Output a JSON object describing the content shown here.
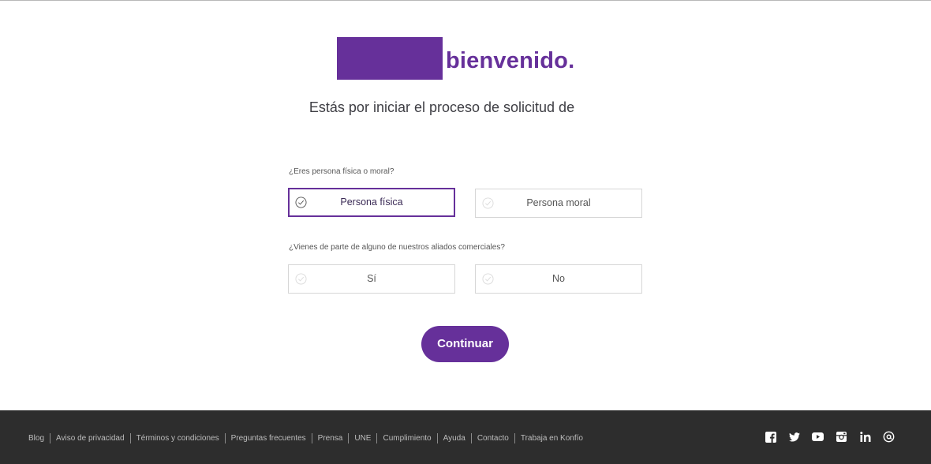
{
  "header": {
    "welcome": "bienvenido."
  },
  "subtitle": "Estás por iniciar el proceso de solicitud de",
  "form": {
    "question_1": "¿Eres persona física o moral?",
    "option_fisica": "Persona física",
    "option_moral": "Persona moral",
    "question_2": "¿Vienes de parte de alguno de nuestros aliados comerciales?",
    "option_si": "Sí",
    "option_no": "No",
    "selected_1": "Persona física",
    "selected_2": ""
  },
  "continue_label": "Continuar",
  "footer": {
    "links": [
      "Blog",
      "Aviso de privacidad",
      "Términos y condiciones",
      "Preguntas frecuentes",
      "Prensa",
      "UNE",
      "Cumplimiento",
      "Ayuda",
      "Contacto",
      "Trabaja en Konfío"
    ],
    "socials": [
      "facebook-icon",
      "twitter-icon",
      "youtube-icon",
      "instagram-icon",
      "linkedin-icon",
      "at-icon"
    ]
  },
  "colors": {
    "brand": "#66309a",
    "footer_bg": "#2d2d2d",
    "check_inactive": "#dcdcdc"
  }
}
